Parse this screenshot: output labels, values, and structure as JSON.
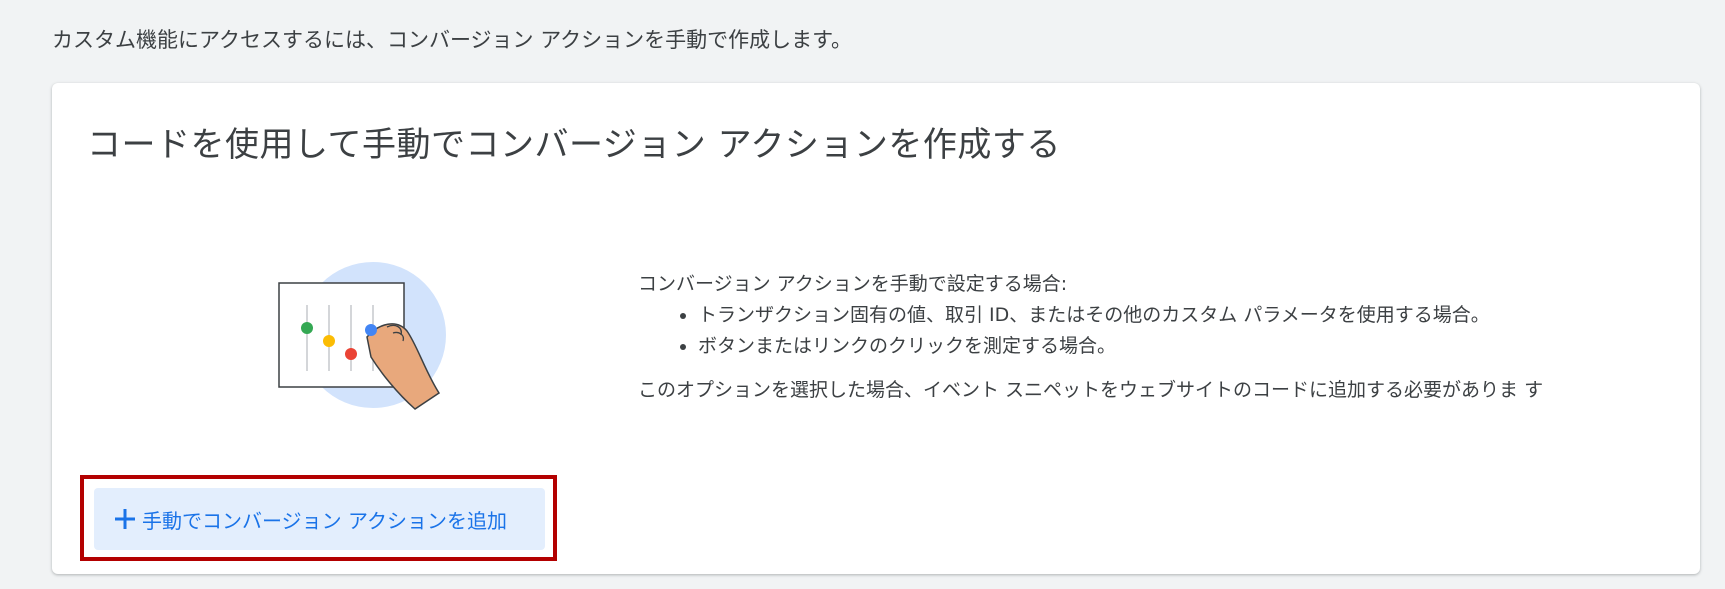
{
  "intro_text": "カスタム機能にアクセスするには、コンバージョン アクションを手動で作成します。",
  "card": {
    "title": "コードを使用して手動でコンバージョン アクションを作成する",
    "details_heading": "コンバージョン アクションを手動で設定する場合:",
    "bullets": [
      "トランザクション固有の値、取引 ID、またはその他のカスタム パラメータを使用する場合。",
      "ボタンまたはリンクのクリックを測定する場合。"
    ],
    "note": "このオプションを選択した場合、イベント スニペットをウェブサイトのコードに追加する必要がありま す",
    "add_button_label": "手動でコンバージョン アクションを追加",
    "add_button_icon": "plus-icon",
    "illustration_icon": "slider-adjust-illustration"
  },
  "colors": {
    "accent": "#1a73e8",
    "button_bg": "#e3eefd",
    "highlight_border": "#b30000",
    "page_bg": "#f1f3f4"
  }
}
